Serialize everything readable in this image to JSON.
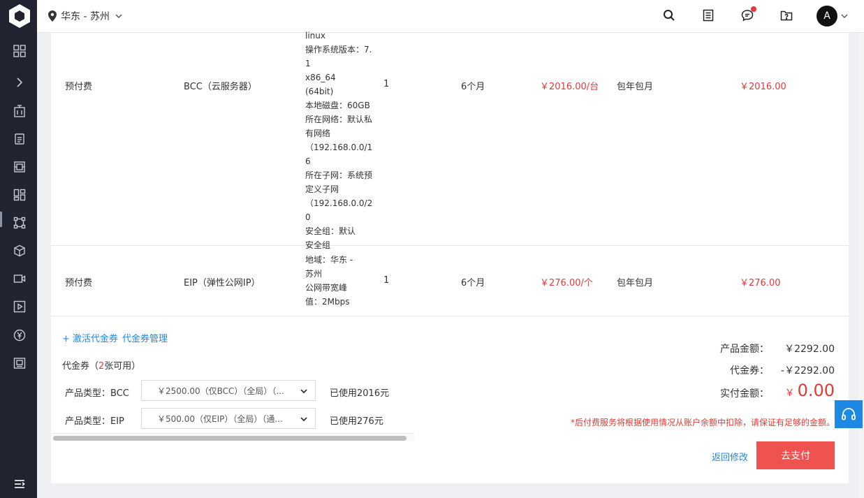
{
  "header": {
    "region": "华东 - 苏州",
    "avatar_initial": "A"
  },
  "colors": {
    "accent": "#1e88e5",
    "price_red": "#e53935",
    "pay_button": "#ef5350",
    "sidebar_bg": "#1f2430"
  },
  "rows": [
    {
      "pay_type": "预付费",
      "product": "BCC（云服务器）",
      "config": [
        "linux",
        "操作系统版本：7.1",
        "x86_64",
        "(64bit)",
        "本地磁盘：60GB",
        "所在网络：默认私有网络",
        "（192.168.0.0/16",
        "所在子网：系统预定义子网",
        "（192.168.0.0/20",
        "安全组：默认",
        "安全组"
      ],
      "quantity": "1",
      "duration": "6个月",
      "unit_price": "￥2016.00/台",
      "billing": "包年包月",
      "total": "￥2016.00"
    },
    {
      "pay_type": "预付费",
      "product": "EIP（弹性公网IP）",
      "config": [
        "地域：华东 - 苏州",
        "公网带宽峰值：2Mbps"
      ],
      "quantity": "1",
      "duration": "6个月",
      "unit_price": "￥276.00/个",
      "billing": "包年包月",
      "total": "￥276.00"
    }
  ],
  "voucher": {
    "activate_link": "+ 激活代金券",
    "manage_link": "代金券管理",
    "title_prefix": "代金券（",
    "title_count": "2",
    "title_suffix": "张可用）",
    "items": [
      {
        "label": "产品类型：BCC",
        "selected": "￥2500.00（仅BCC）（全局）（...",
        "used": "已使用2016元"
      },
      {
        "label": "产品类型：EIP",
        "selected": "￥500.00（仅EIP）（全局）（通...",
        "used": "已使用276元"
      }
    ]
  },
  "summary": {
    "product_amount_label": "产品金额：",
    "product_amount": "￥2292.00",
    "voucher_label": "代金券：",
    "voucher_amount": "-￥2292.00",
    "pay_label": "实付金额：",
    "pay_currency": "￥",
    "pay_amount": "0.00",
    "notice": "*后付费服务将根据使用情况从账户余额中扣除，请保证有足够的金额。",
    "back_label": "返回修改",
    "pay_button": "去支付"
  }
}
